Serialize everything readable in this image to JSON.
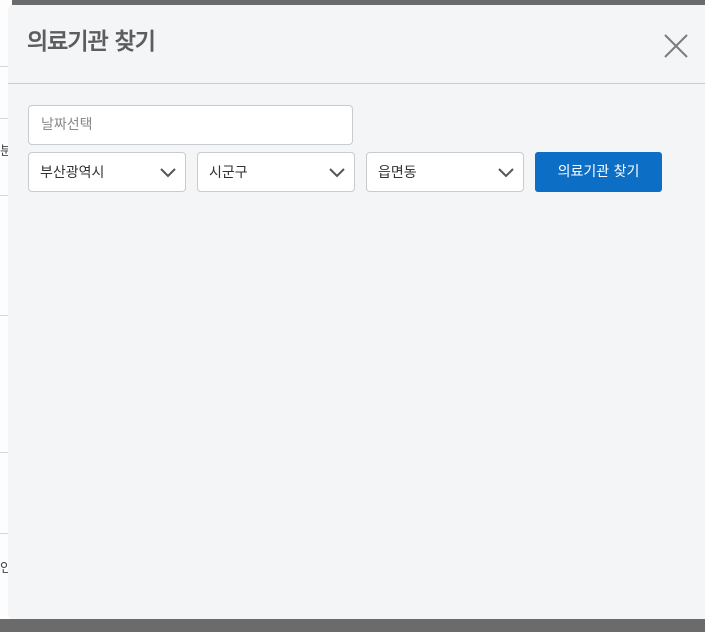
{
  "modal": {
    "title": "의료기관 찾기",
    "close_icon": "close-x-icon"
  },
  "form": {
    "date_placeholder": "날짜선택",
    "date_value": "",
    "province_selected": "부산광역시",
    "district_selected": "시군구",
    "town_selected": "읍면동",
    "chevron_icon": "chevron-down-icon",
    "search_label": "의료기관 찾기"
  },
  "background_page": {
    "fragments": [
      "분",
      "인"
    ]
  },
  "colors": {
    "accent": "#0d6ec5",
    "modal_bg": "#f4f5f7",
    "overlay": "#6b6b6b",
    "title": "#5d5d5d"
  }
}
